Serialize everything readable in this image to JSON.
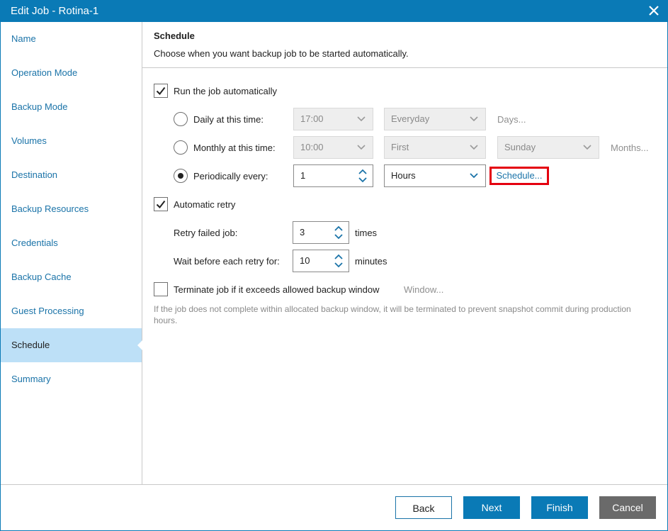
{
  "window": {
    "title": "Edit Job - Rotina-1",
    "close_icon": "close-icon"
  },
  "sidebar": {
    "items": [
      {
        "label": "Name"
      },
      {
        "label": "Operation Mode"
      },
      {
        "label": "Backup Mode"
      },
      {
        "label": "Volumes"
      },
      {
        "label": "Destination"
      },
      {
        "label": "Backup Resources"
      },
      {
        "label": "Credentials"
      },
      {
        "label": "Backup Cache"
      },
      {
        "label": "Guest Processing"
      },
      {
        "label": "Schedule",
        "active": true
      },
      {
        "label": "Summary"
      }
    ]
  },
  "header": {
    "title": "Schedule",
    "subtitle": "Choose when you want backup job to be started automatically."
  },
  "schedule": {
    "run_auto_label": "Run the job automatically",
    "run_auto_checked": true,
    "daily": {
      "label": "Daily at this time:",
      "time": "17:00",
      "days_value": "Everyday",
      "link": "Days..."
    },
    "monthly": {
      "label": "Monthly at this time:",
      "time": "10:00",
      "ordinal": "First",
      "weekday": "Sunday",
      "link": "Months..."
    },
    "periodic": {
      "label": "Periodically every:",
      "value": "1",
      "unit": "Hours",
      "link": "Schedule...",
      "selected": true
    },
    "retry_label": "Automatic retry",
    "retry_checked": true,
    "retry_failed_label": "Retry failed job:",
    "retry_failed_value": "3",
    "retry_failed_unit": "times",
    "wait_label": "Wait before each retry for:",
    "wait_value": "10",
    "wait_unit": "minutes",
    "terminate_label": "Terminate job if it exceeds allowed backup window",
    "terminate_checked": false,
    "window_link": "Window...",
    "note": "If the job does not complete within allocated backup window, it will be terminated to prevent snapshot commit during production hours."
  },
  "footer": {
    "back": "Back",
    "next": "Next",
    "finish": "Finish",
    "cancel": "Cancel"
  },
  "colors": {
    "accent": "#0a7ab6",
    "active_nav": "#bde0f7",
    "highlight": "#e4000f",
    "link": "#1a73a8"
  }
}
